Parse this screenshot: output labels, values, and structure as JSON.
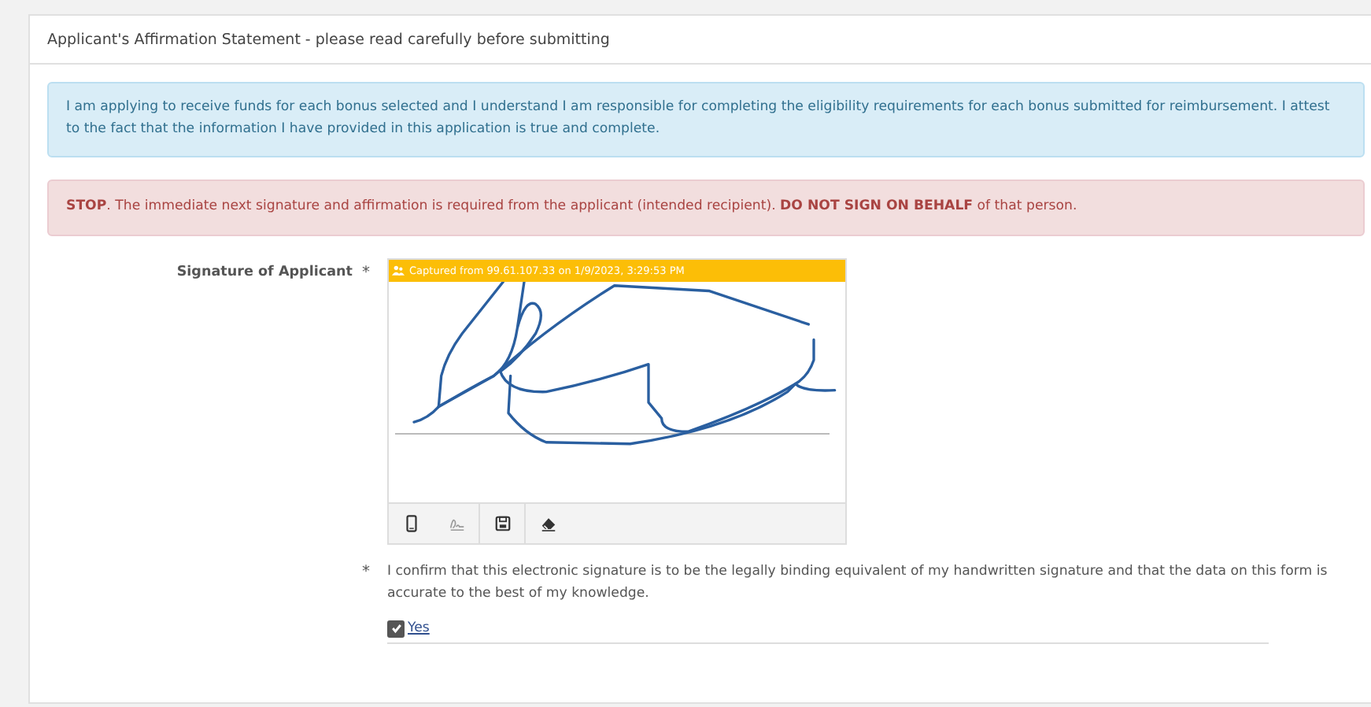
{
  "panel": {
    "title": "Applicant's Affirmation Statement - please read carefully before submitting"
  },
  "alerts": [
    {
      "kind": "info",
      "text": "I am applying to receive funds for each bonus selected and I understand I am responsible for completing the eligibility requirements for each bonus submitted for reimbursement. I attest to the fact that the information I have provided in this application is true and complete."
    },
    {
      "kind": "danger",
      "text": "**STOP**. The immediate next signature and affirmation is required from the applicant (intended recipient). **DO NOT SIGN ON BEHALF** of that person."
    }
  ],
  "signature": {
    "label": "Signature of Applicant",
    "required_mark": "*",
    "captured": "Captured from 99.61.107.33 on 1/9/2023, 3:29:53 PM",
    "tools": [
      {
        "kind": "device"
      },
      {
        "kind": "sign",
        "disabled": true
      },
      {
        "kind": "save",
        "disabled": false
      },
      {
        "kind": "erase",
        "disabled": false
      }
    ]
  },
  "confirmation": {
    "required_mark": "*",
    "text": "I confirm that this electronic signature is to be the legally binding equivalent of my handwritten signature and that the data on this form is accurate to the best of my knowledge.",
    "option": {
      "label": "Yes",
      "checked": true
    }
  }
}
